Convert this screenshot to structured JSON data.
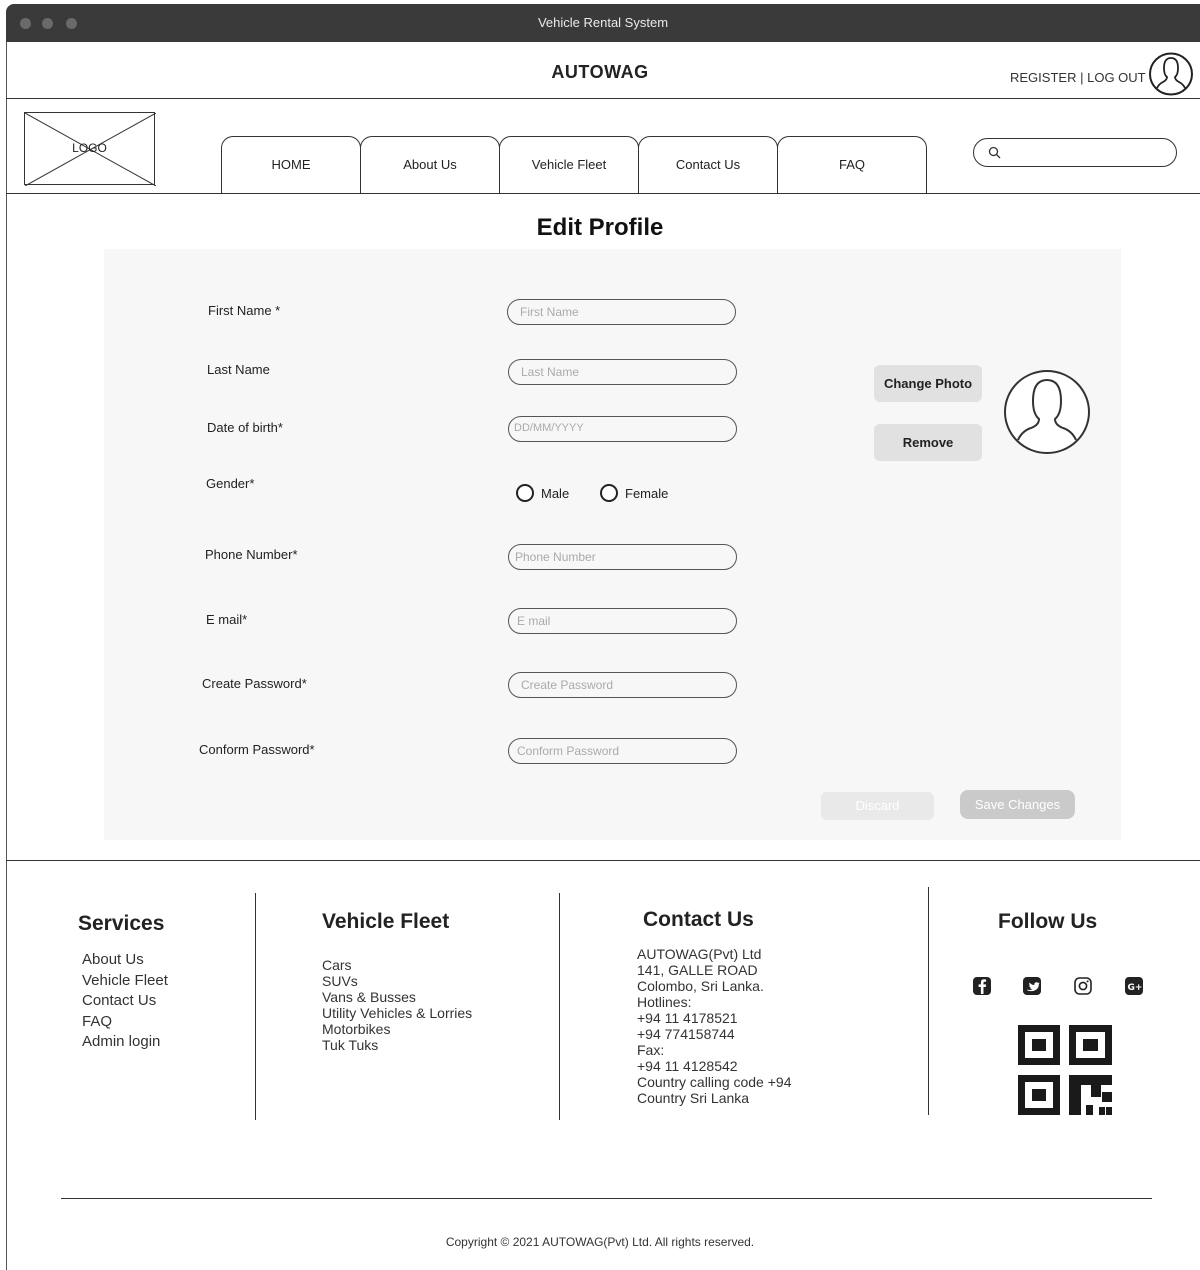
{
  "window": {
    "title": "Vehicle Rental System"
  },
  "header": {
    "brand": "AUTOWAG",
    "register": "REGISTER",
    "separator": "|",
    "logout": "LOG OUT"
  },
  "logo": {
    "label": "LOGO"
  },
  "nav": {
    "tabs": [
      {
        "label": "HOME"
      },
      {
        "label": "About Us"
      },
      {
        "label": "Vehicle Fleet"
      },
      {
        "label": "Contact Us"
      },
      {
        "label": "FAQ"
      }
    ],
    "search_placeholder": ""
  },
  "page": {
    "title": "Edit Profile"
  },
  "form": {
    "first_name": {
      "label": "First Name *",
      "placeholder": "First Name"
    },
    "last_name": {
      "label": "Last Name",
      "placeholder": "Last Name"
    },
    "dob": {
      "label": "Date of birth*",
      "placeholder": "DD/MM/YYYY"
    },
    "gender": {
      "label": "Gender*",
      "options": [
        "Male",
        "Female"
      ]
    },
    "phone": {
      "label": "Phone Number*",
      "placeholder": "Phone Number"
    },
    "email": {
      "label": "E mail*",
      "placeholder": "E mail"
    },
    "password": {
      "label": "Create Password*",
      "placeholder": "Create Password"
    },
    "confirm": {
      "label": "Conform Password*",
      "placeholder": "Conform Password"
    },
    "change_photo": "Change Photo",
    "remove": "Remove",
    "discard": "Discard",
    "save": "Save Changes"
  },
  "footer": {
    "services": {
      "title": "Services",
      "items": [
        "About Us",
        "Vehicle Fleet",
        "Contact Us",
        "FAQ",
        "Admin login"
      ]
    },
    "fleet": {
      "title": "Vehicle Fleet",
      "items": [
        "Cars",
        "SUVs",
        "Vans & Busses",
        "Utility Vehicles & Lorries",
        "Motorbikes",
        "Tuk Tuks"
      ]
    },
    "contact": {
      "title": "Contact Us",
      "lines": [
        "AUTOWAG(Pvt) Ltd",
        "141, GALLE ROAD",
        "Colombo, Sri Lanka.",
        "Hotlines:",
        "+94 11 4178521",
        "+94 774158744",
        "Fax:",
        "+94 11 4128542",
        "Country calling code +94",
        "Country Sri Lanka"
      ]
    },
    "follow": {
      "title": "Follow Us",
      "icons": [
        "facebook-icon",
        "twitter-icon",
        "instagram-icon",
        "google-plus-icon"
      ]
    },
    "copyright": "Copyright © 2021 AUTOWAG(Pvt) Ltd. All rights reserved."
  }
}
